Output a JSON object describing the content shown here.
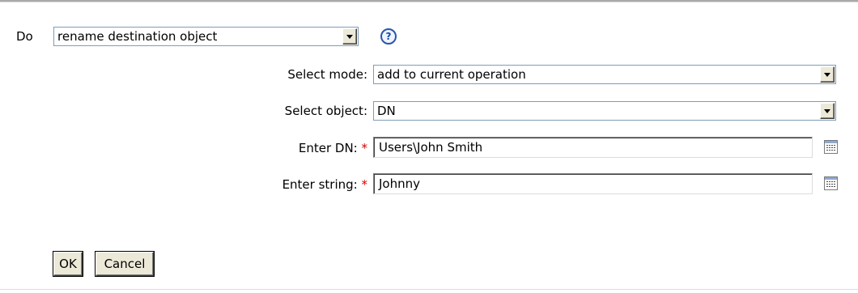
{
  "do_row": {
    "label": "Do",
    "selected_action": "rename destination object",
    "help_icon": "help-icon"
  },
  "fields": {
    "select_mode": {
      "label": "Select mode:",
      "value": "add to current operation"
    },
    "select_object": {
      "label": "Select object:",
      "value": "DN"
    },
    "enter_dn": {
      "label": "Enter DN:",
      "required_mark": "*",
      "value": "Users\\John Smith",
      "editor_icon": "argument-builder-icon"
    },
    "enter_string": {
      "label": "Enter string:",
      "required_mark": "*",
      "value": "Johnny",
      "editor_icon": "argument-builder-icon"
    }
  },
  "buttons": {
    "ok_label": "OK",
    "cancel_label": "Cancel"
  },
  "colors": {
    "required": "#d40000",
    "help_icon": "#2b55a8",
    "button_face": "#ece9d8",
    "field_border": "#7f9db9"
  }
}
